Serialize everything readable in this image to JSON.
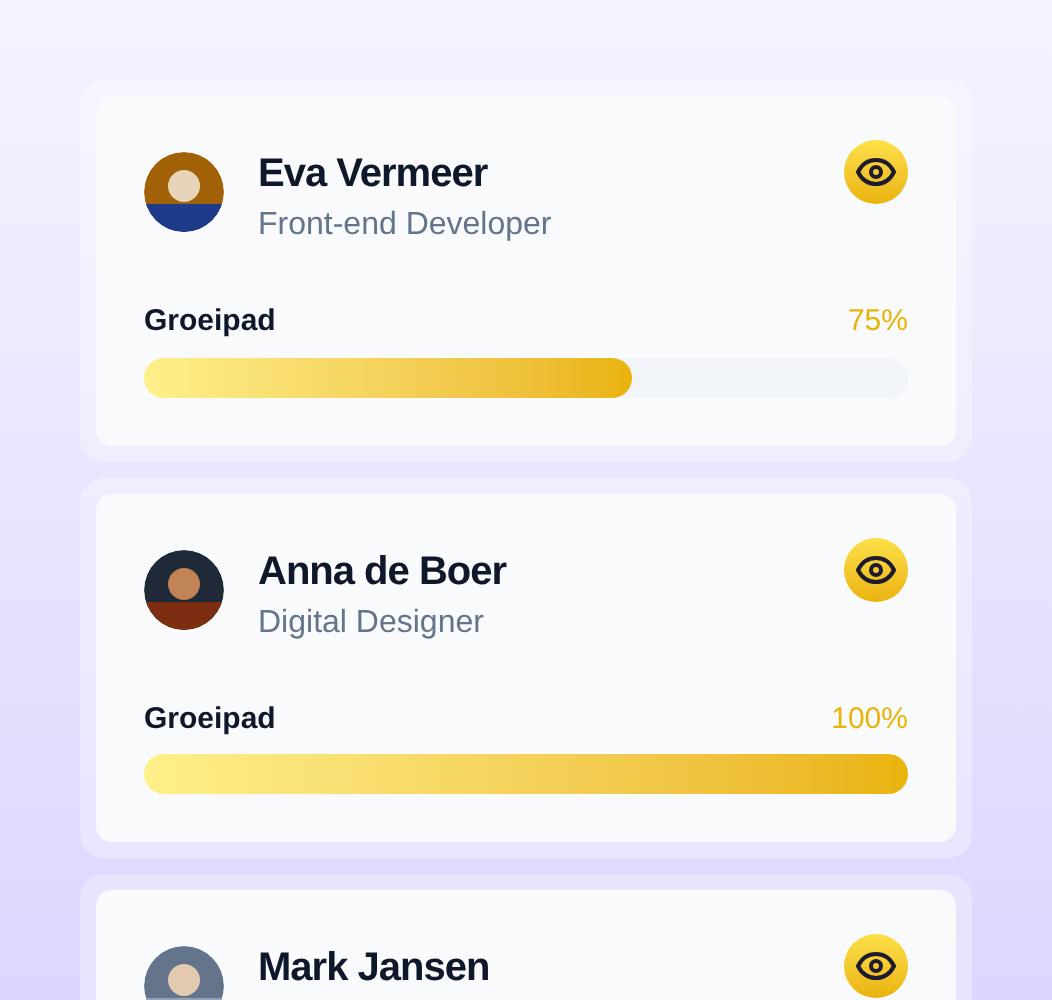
{
  "members": [
    {
      "name": "Eva Vermeer",
      "role": "Front-end Developer",
      "progress_label": "Groeipad",
      "progress_text": "75%",
      "level": 0.64
    },
    {
      "name": "Anna de Boer",
      "role": "Digital Designer",
      "progress_label": "Groeipad",
      "progress_text": "100%",
      "level": 1
    },
    {
      "name": "Mark Jansen"
    }
  ]
}
